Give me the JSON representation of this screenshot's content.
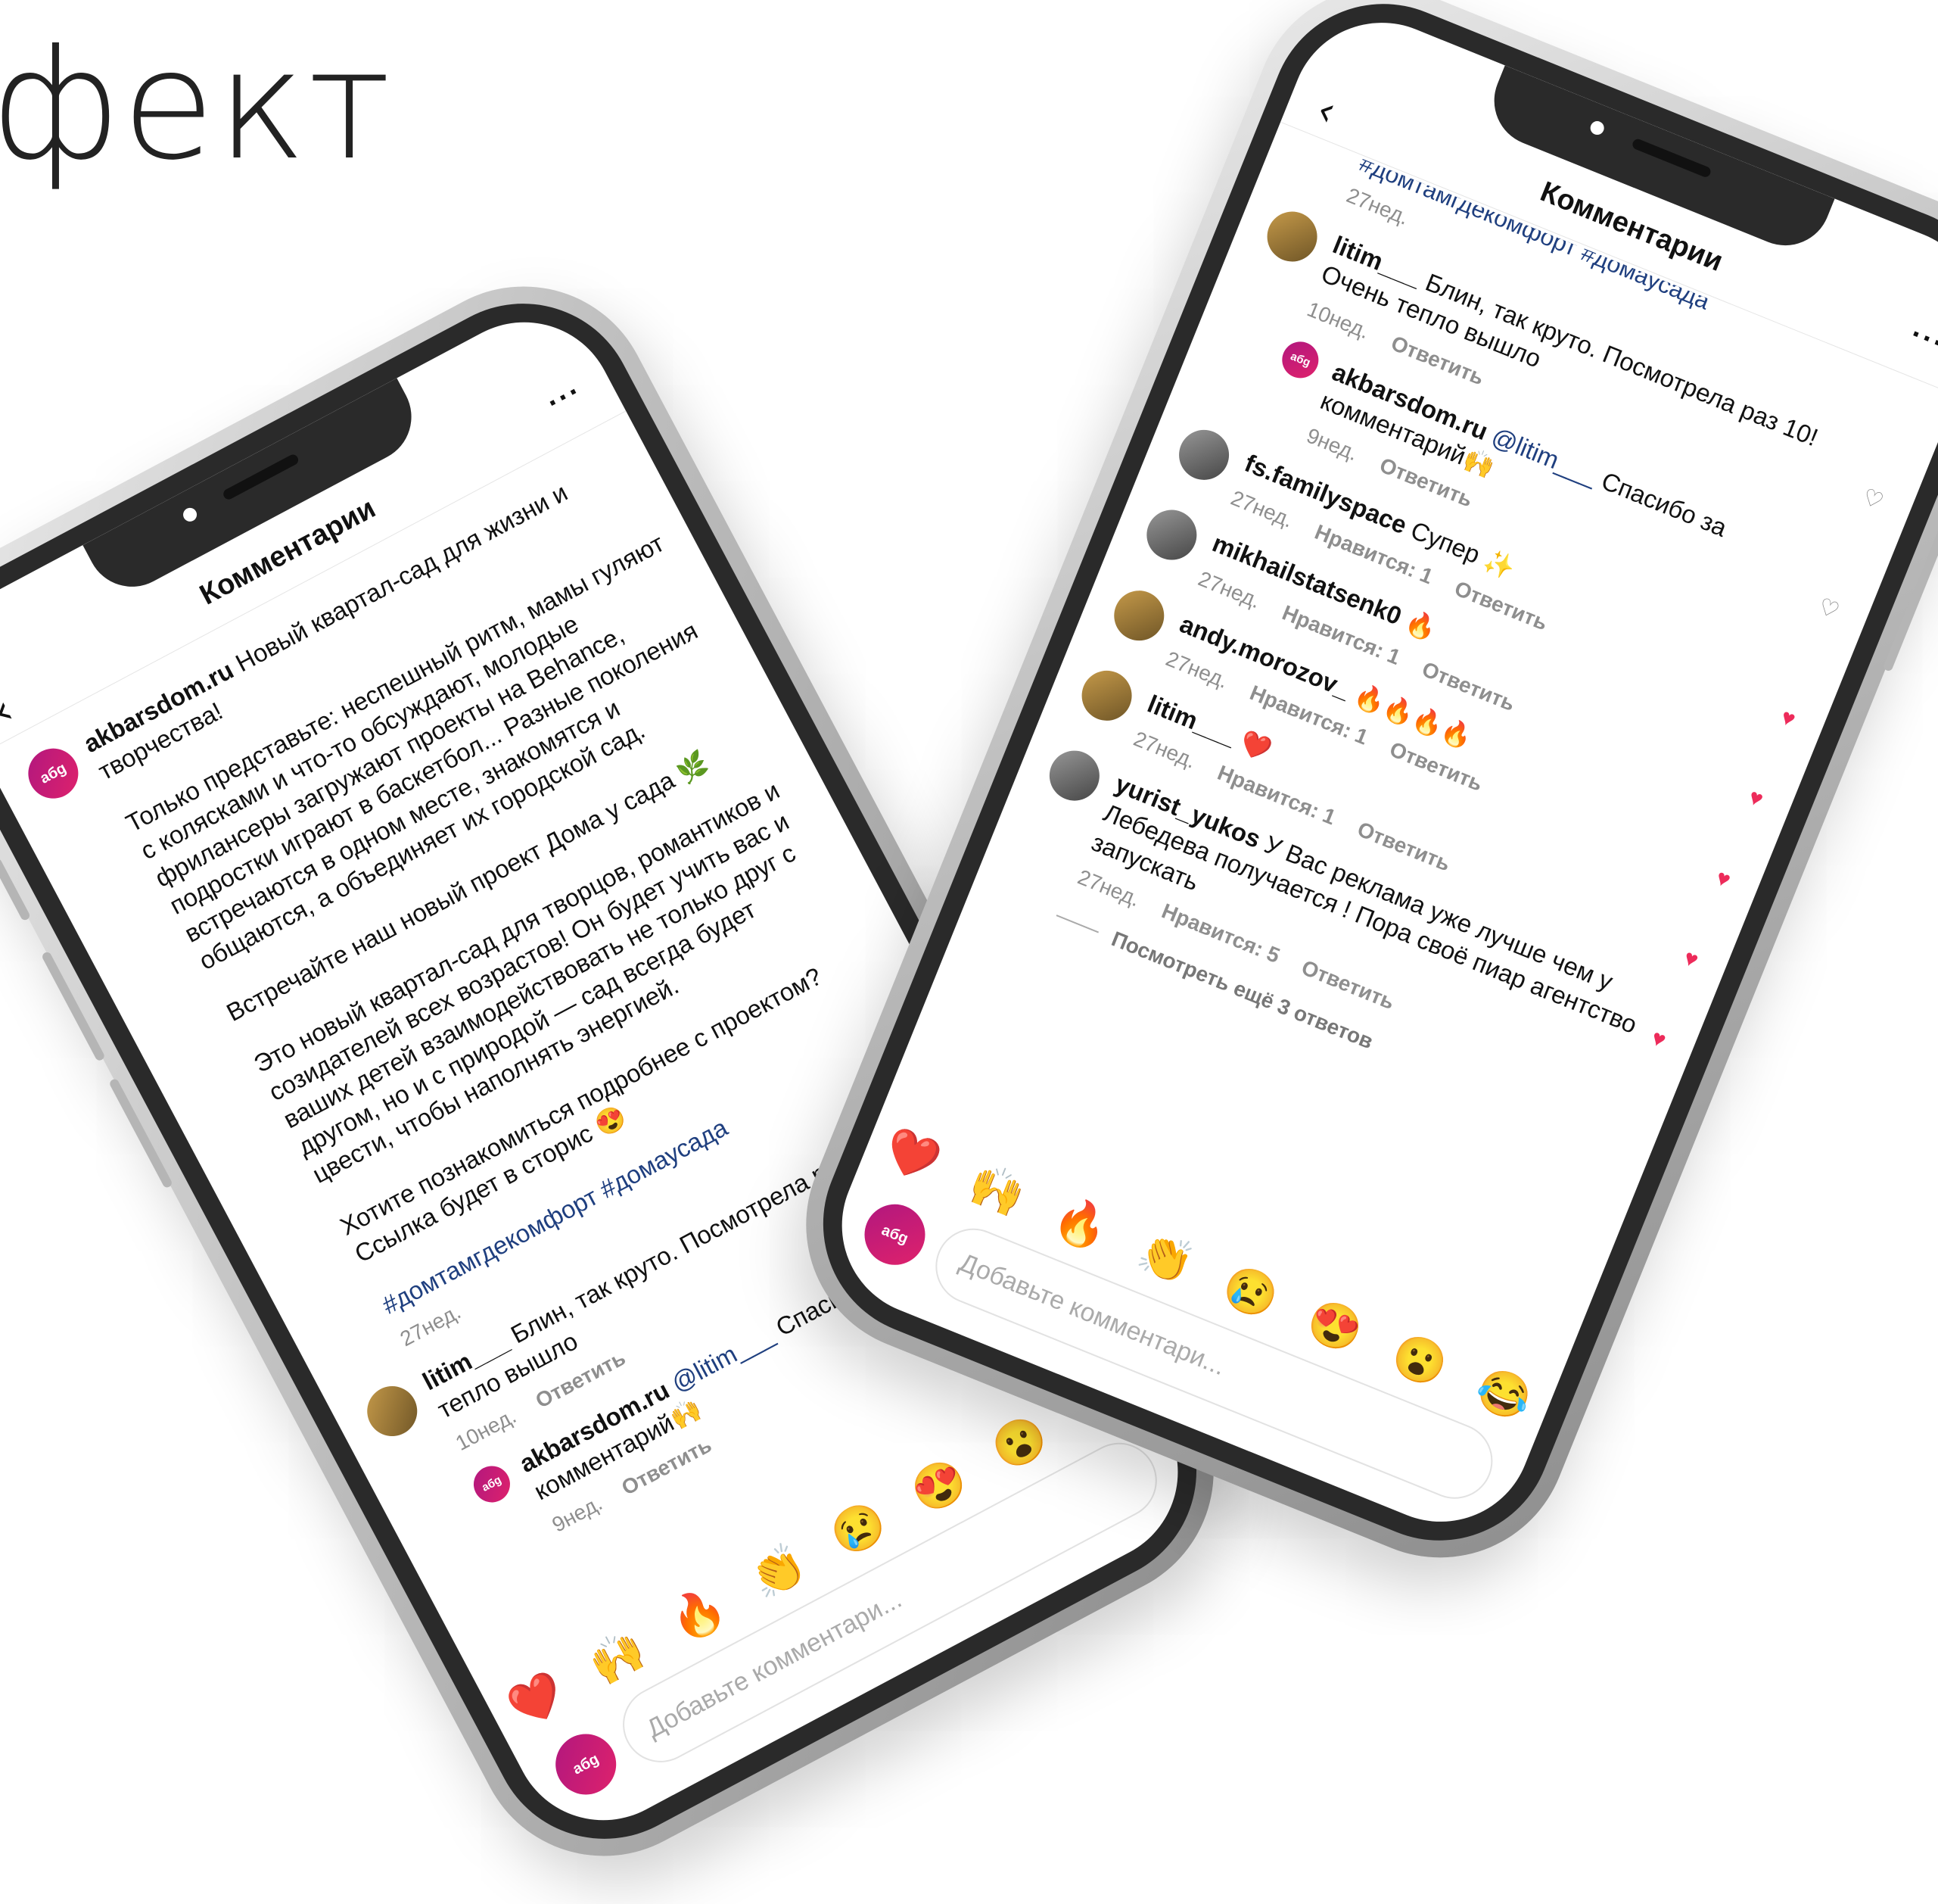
{
  "headline": "фект",
  "brand_avatar_text": "абg",
  "phone_left": {
    "title": "Комментарии",
    "caption": {
      "username": "akbarsdom.ru",
      "p1": "Новый квартал-сад для жизни и творчества!",
      "p2": "Только представьте: неспешный ритм, мамы гуляют с колясками и что-то обсуждают, молодые фрилансеры загружают проекты на Behance, подростки играют в баскетбол... Разные поколения встречаются в одном месте, знакомятся и общаются, а объединяет их городской сад.",
      "p3": "Встречайте наш новый проект Дома у сада 🌿",
      "p4": "Это новый квартал-сад для творцов, романтиков и созидателей всех возрастов! Он будет учить вас и ваших детей взаимодействовать не только друг с другом, но и с природой — сад всегда будет цвести, чтобы наполнять энергией.",
      "p5": "Хотите познакомиться подробнее с проектом? Ссылка будет в сторис 😍",
      "tags": "#домтамгдекомфорт #домаусада",
      "time": "27нед."
    },
    "comments": [
      {
        "user": "litim___",
        "text": "Блин, так круто. Посмотрела раз 10! Очень тепло вышло",
        "time": "10нед.",
        "reply": "Ответить"
      },
      {
        "user": "akbarsdom.ru",
        "mention": "@litim___",
        "text": "Спасибо за комментарий🙌",
        "time": "9нед.",
        "reply": "Ответить"
      }
    ],
    "emojis": [
      "❤️",
      "🙌",
      "🔥",
      "👏",
      "😢",
      "😍",
      "😮",
      "😂"
    ],
    "input_placeholder": "Добавьте комментари..."
  },
  "phone_right": {
    "title": "Комментарии",
    "top_tags": "#домтамгдекомфорт #домаусада",
    "top_time": "27нед.",
    "comments": [
      {
        "user": "litim___",
        "text": "Блин, так круто. Посмотрела раз 10! Очень тепло вышло",
        "time": "10нед.",
        "likes": "",
        "reply": "Ответить"
      },
      {
        "user": "akbarsdom.ru",
        "mention": "@litim___",
        "text": "Спасибо за комментарий🙌",
        "time": "9нед.",
        "likes": "",
        "reply": "Ответить"
      },
      {
        "user": "fs.familyspace",
        "text": "Супер ✨",
        "time": "27нед.",
        "likes": "Нравится: 1",
        "reply": "Ответить"
      },
      {
        "user": "mikhailstatsenk0",
        "text": "🔥",
        "time": "27нед.",
        "likes": "Нравится: 1",
        "reply": "Ответить"
      },
      {
        "user": "andy.morozov_",
        "text": "🔥🔥🔥🔥",
        "time": "27нед.",
        "likes": "Нравится: 1",
        "reply": "Ответить"
      },
      {
        "user": "litim___",
        "text": "❤️",
        "time": "27нед.",
        "likes": "Нравится: 1",
        "reply": "Ответить"
      },
      {
        "user": "yurist_yukos",
        "text": "У Вас реклама уже лучше чем у Лебедева получается ! Пора своё пиар агентство запускать",
        "time": "27нед.",
        "likes": "Нравится: 5",
        "reply": "Ответить"
      }
    ],
    "view_more": "Посмотреть ещё 3 ответов",
    "emojis": [
      "❤️",
      "🙌",
      "🔥",
      "👏",
      "😢",
      "😍",
      "😮",
      "😂"
    ],
    "input_placeholder": "Добавьте комментари..."
  }
}
